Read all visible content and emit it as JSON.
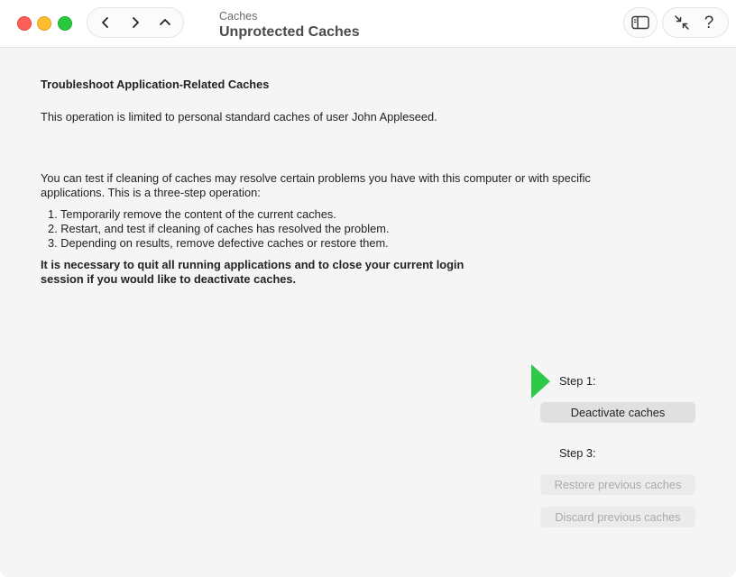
{
  "window": {
    "breadcrumb": "Caches",
    "title": "Unprotected Caches",
    "icons": {
      "back": "chevron-left-icon",
      "forward": "chevron-right-icon",
      "up": "chevron-up-icon",
      "sidebar": "sidebar-icon",
      "collapse": "collapse-arrows-icon",
      "help": "?"
    }
  },
  "main": {
    "heading": "Troubleshoot Application-Related Caches",
    "limited": "This operation is limited to personal standard caches of user John Appleseed.",
    "intro": "You can test if cleaning of caches may resolve certain problems you have with this computer or with specific applications. This is a three-step operation:",
    "steps": [
      "1. Temporarily remove the content of the current caches.",
      "2. Restart, and test if cleaning of caches has resolved the problem.",
      "3. Depending on results, remove defective caches or restore them."
    ],
    "warning": "It is necessary to quit all running applications and to close your current login session if you would like to deactivate caches."
  },
  "actions": {
    "step1_label": "Step 1:",
    "deactivate_label": "Deactivate caches",
    "step3_label": "Step 3:",
    "restore_label": "Restore previous caches",
    "discard_label": "Discard previous caches",
    "current_step_color": "#2fc94a"
  }
}
